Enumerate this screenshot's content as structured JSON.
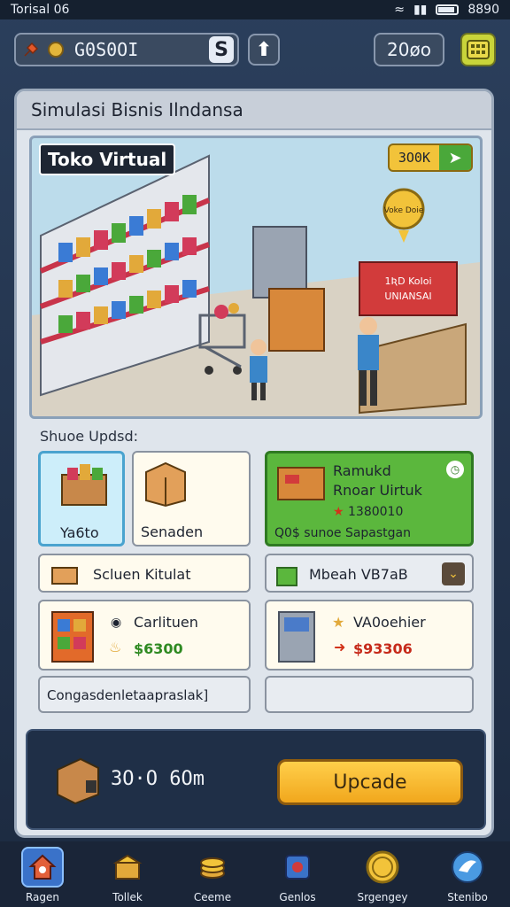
{
  "status": {
    "time": "Torisal 06",
    "clock": "8890"
  },
  "hud": {
    "coins": "G0S0OI",
    "currency_symbol": "S",
    "gem_symbol": "⬆",
    "percent": "20øo"
  },
  "panel": {
    "title": "Simulasi Bisnis Ilndansa"
  },
  "scene": {
    "title": "Toko Virtual",
    "badge_amount": "3O0K",
    "sign_bubble": "Voke Doie",
    "counter_sign_line1": "1ƦD KoIoi",
    "counter_sign_line2": "UNIANSAI"
  },
  "section": {
    "label": "Shuoe Updsd:"
  },
  "cards": {
    "card1": {
      "label": "Ya6to"
    },
    "card2": {
      "label": "Senaden"
    },
    "card3": {
      "title1": "Ramukd",
      "title2": "Rnoar Uirtuk",
      "price": "1380010",
      "footer": "Q0$ sunoe Sapastgan"
    },
    "card4": {
      "label": "Scluen Kitulat"
    },
    "card5": {
      "label": "Mbeah VB7aB"
    },
    "card6": {
      "name": "Carlituen",
      "price": "$6300"
    },
    "card7": {
      "name": "VA0oehier",
      "price": "$93306"
    },
    "card8": {
      "label": "Congasdenletaapraslak]"
    },
    "card9": {
      "label": ""
    }
  },
  "buy": {
    "price": "3O·O 6Om",
    "button": "Upcade"
  },
  "nav": {
    "items": [
      {
        "label": "Ragen"
      },
      {
        "label": "Tollek"
      },
      {
        "label": "Ceeme"
      },
      {
        "label": "Genlos"
      },
      {
        "label": "Srgengey"
      },
      {
        "label": "Stenibo"
      }
    ]
  },
  "colors": {
    "accent_yellow": "#f2c33a",
    "accent_green": "#5bb73d",
    "selected_blue": "#cdeefa"
  }
}
